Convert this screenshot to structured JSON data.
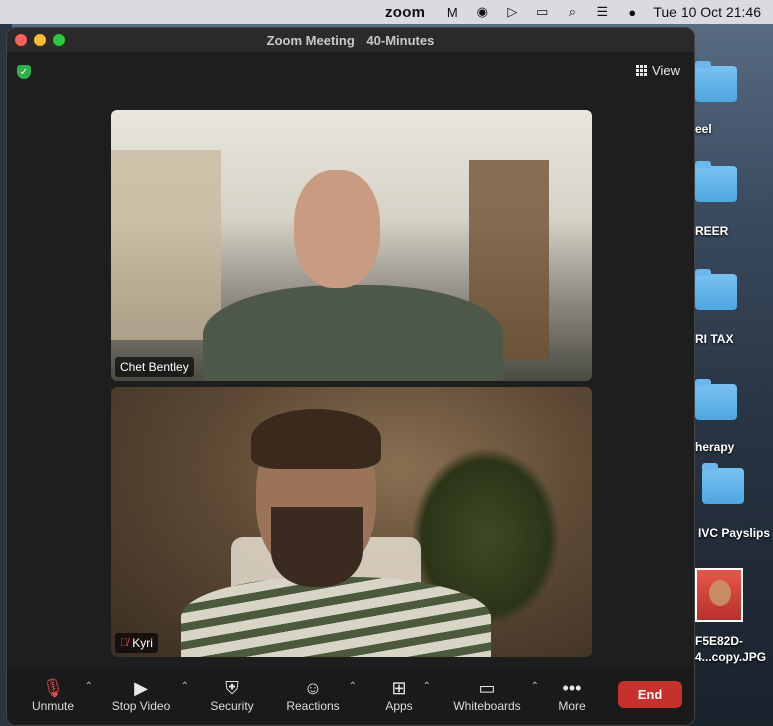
{
  "menubar": {
    "app_name": "zoom",
    "datetime": "Tue 10 Oct  21:46",
    "icons": [
      "gmail-icon",
      "vpn-icon",
      "play-icon",
      "battery-icon",
      "search-icon",
      "control-center-icon",
      "siri-icon"
    ]
  },
  "window": {
    "title": "Zoom Meeting",
    "subtitle": "40-Minutes",
    "view_label": "View"
  },
  "participants": [
    {
      "name": "Chet Bentley",
      "muted": false
    },
    {
      "name": "Kyri",
      "muted": true
    }
  ],
  "toolbar": {
    "unmute": "Unmute",
    "stop_video": "Stop Video",
    "security": "Security",
    "reactions": "Reactions",
    "apps": "Apps",
    "whiteboards": "Whiteboards",
    "more": "More",
    "end": "End"
  },
  "desktop_items": [
    {
      "label": "eel"
    },
    {
      "label": "REER"
    },
    {
      "label": "RI TAX"
    },
    {
      "label": "herapy"
    },
    {
      "label": "IVC Payslips"
    },
    {
      "label": "F5E82D-"
    },
    {
      "label": "4...copy.JPG"
    }
  ],
  "colors": {
    "end_button": "#c8302b",
    "shield": "#2fb14a",
    "muted_icon": "#e5484d"
  }
}
